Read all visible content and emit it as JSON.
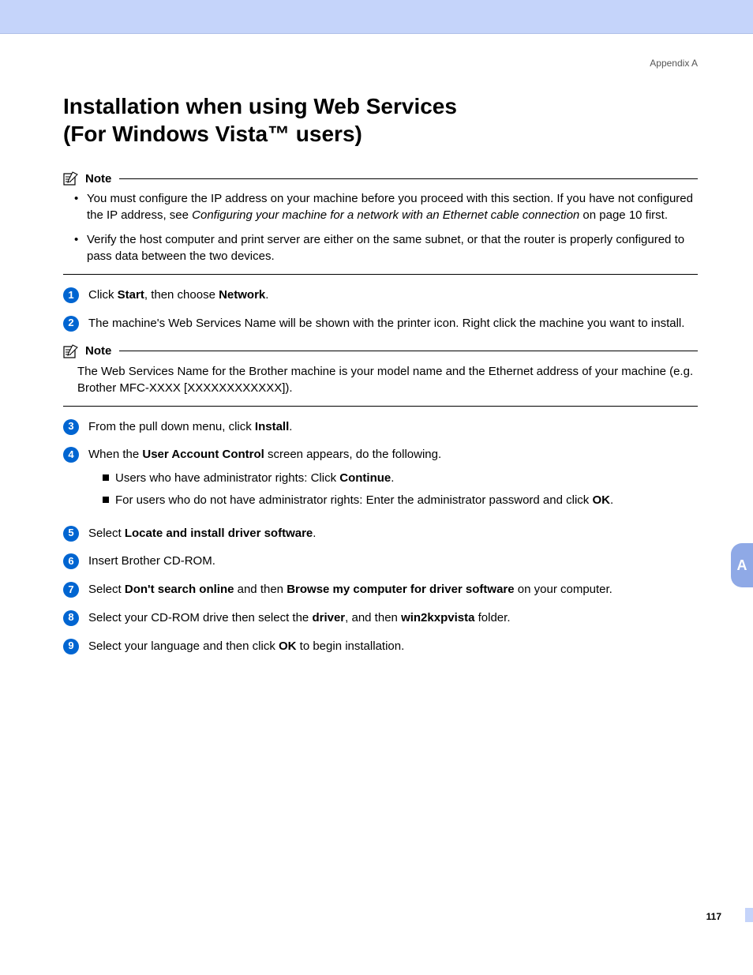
{
  "header": {
    "appendix": "Appendix A"
  },
  "title": {
    "line1": "Installation when using Web Services",
    "line2": "(For Windows Vista™ users)"
  },
  "note1": {
    "label": "Note",
    "bullet1_pre": "You must configure the IP address on your machine before you proceed with this section. If you have not configured the IP address, see ",
    "bullet1_em": "Configuring your machine for a network with an Ethernet cable connection",
    "bullet1_post": " on page 10 first.",
    "bullet2": "Verify the host computer and print server are either on the same subnet, or that the router is properly configured to pass data between the two devices."
  },
  "steps": {
    "s1": {
      "num": "1",
      "t1": "Click ",
      "b1": "Start",
      "t2": ", then choose ",
      "b2": "Network",
      "t3": "."
    },
    "s2": {
      "num": "2",
      "text": "The machine's Web Services Name will be shown with the printer icon. Right click the machine you want to install."
    },
    "s3": {
      "num": "3",
      "t1": "From the pull down menu, click ",
      "b1": "Install",
      "t2": "."
    },
    "s4": {
      "num": "4",
      "t1": "When the ",
      "b1": "User Account Control",
      "t2": " screen appears, do the following.",
      "sub1": {
        "t1": "Users who have administrator rights: Click ",
        "b1": "Continue",
        "t2": "."
      },
      "sub2": {
        "t1": "For users who do not have administrator rights: Enter the administrator password and click ",
        "b1": "OK",
        "t2": "."
      }
    },
    "s5": {
      "num": "5",
      "t1": "Select ",
      "b1": "Locate and install driver software",
      "t2": "."
    },
    "s6": {
      "num": "6",
      "text": "Insert Brother CD-ROM."
    },
    "s7": {
      "num": "7",
      "t1": "Select ",
      "b1": "Don't search online",
      "t2": " and then ",
      "b2": "Browse my computer for driver software",
      "t3": " on your computer."
    },
    "s8": {
      "num": "8",
      "t1": "Select your CD-ROM drive then select the ",
      "b1": "driver",
      "t2": ", and then ",
      "b2": "win2kxpvista",
      "t3": " folder."
    },
    "s9": {
      "num": "9",
      "t1": "Select your language and then click ",
      "b1": "OK",
      "t2": " to begin installation."
    }
  },
  "note2": {
    "label": "Note",
    "text": "The Web Services Name for the Brother machine is your model name and the Ethernet address of your machine (e.g. Brother MFC-XXXX [XXXXXXXXXXXX])."
  },
  "sidetab": "A",
  "pagenum": "117"
}
